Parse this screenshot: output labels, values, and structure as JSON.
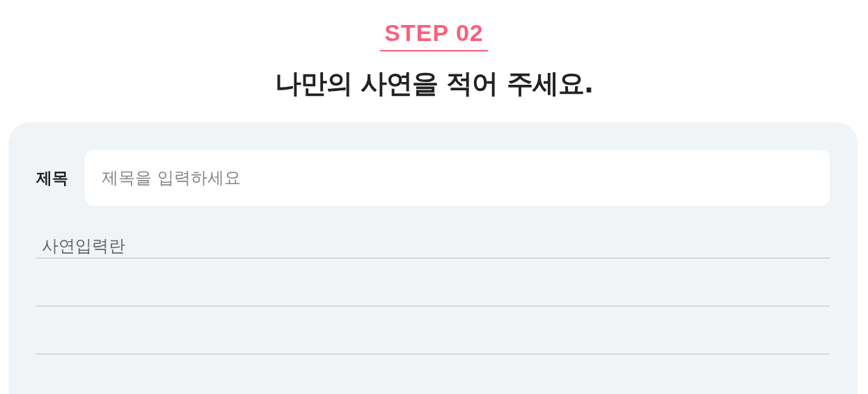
{
  "step": "STEP 02",
  "heading": "나만의 사연을 적어 주세요.",
  "form": {
    "title_label": "제목",
    "title_placeholder": "제목을 입력하세요",
    "story_placeholder": "사연입력란"
  }
}
